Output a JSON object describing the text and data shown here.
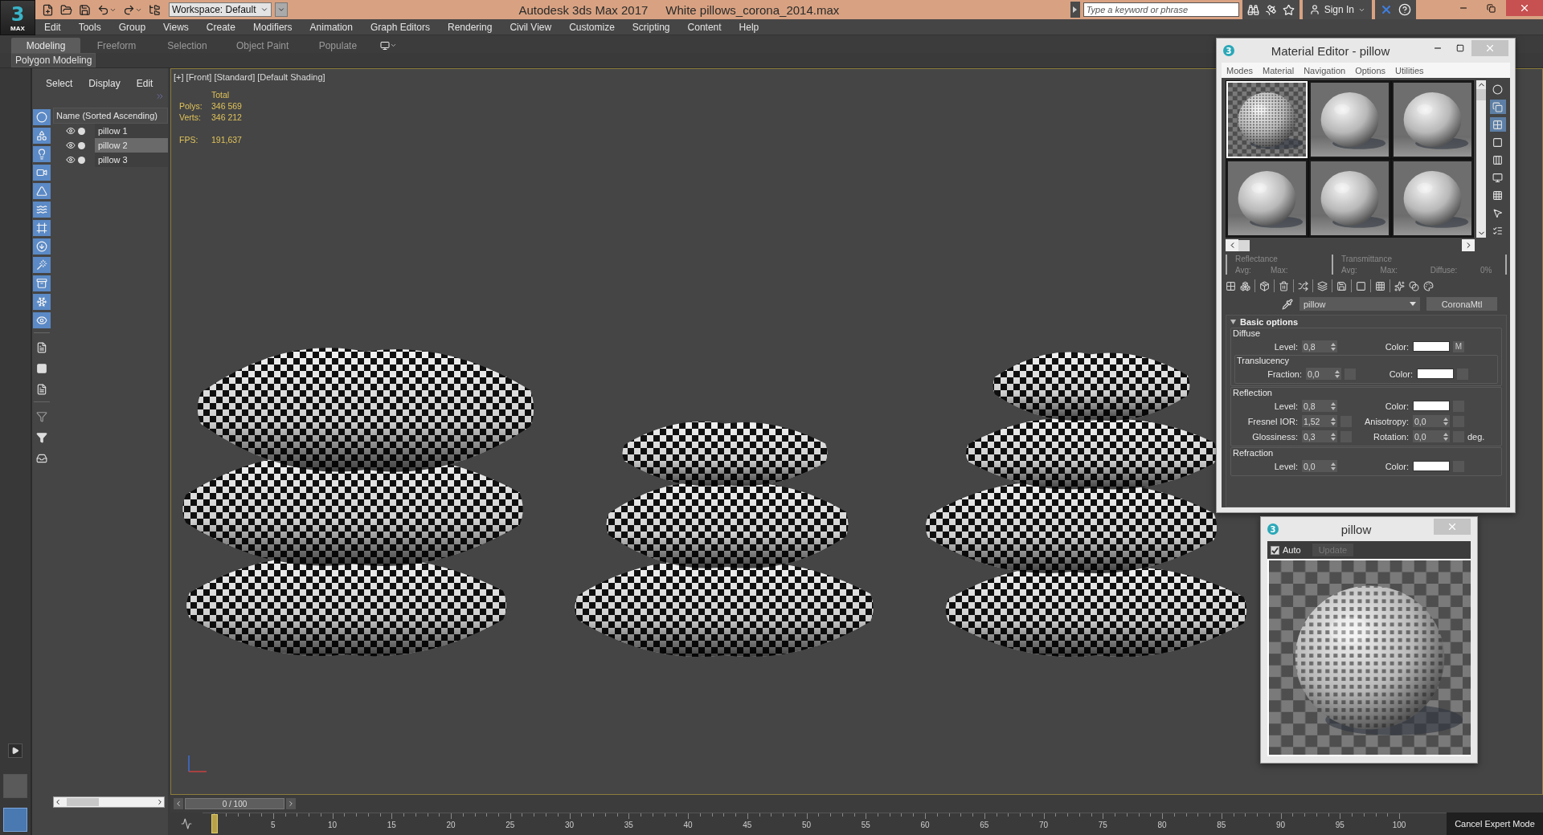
{
  "title_bar": {
    "logo": {
      "glyph": "3",
      "label": "MAX"
    },
    "workspace": "Workspace: Default",
    "app_title": "Autodesk 3ds Max 2017",
    "file_name": "White pillows_corona_2014.max",
    "search": {
      "placeholder": "Type a keyword or phrase"
    },
    "sign_in": "Sign In"
  },
  "menu": [
    "Edit",
    "Tools",
    "Group",
    "Views",
    "Create",
    "Modifiers",
    "Animation",
    "Graph Editors",
    "Rendering",
    "Civil View",
    "Customize",
    "Scripting",
    "Content",
    "Help"
  ],
  "ribbon": {
    "tabs": [
      {
        "label": "Modeling",
        "selected": true
      },
      {
        "label": "Freeform",
        "selected": false
      },
      {
        "label": "Selection",
        "selected": false
      },
      {
        "label": "Object Paint",
        "selected": false
      },
      {
        "label": "Populate",
        "selected": false
      }
    ],
    "panel": "Polygon Modeling"
  },
  "scene_explorer": {
    "tabs": [
      "Select",
      "Display",
      "Edit"
    ],
    "column": "Name (Sorted Ascending)",
    "items": [
      {
        "name": "pillow 1",
        "selected": false
      },
      {
        "name": "pillow 2",
        "selected": true
      },
      {
        "name": "pillow 3",
        "selected": false
      }
    ]
  },
  "viewport": {
    "label": "[+] [Front] [Standard] [Default Shading]",
    "stats": {
      "header": "Total",
      "rows": [
        {
          "label": "Polys:",
          "value": "346 569"
        },
        {
          "label": "Verts:",
          "value": "346 212"
        }
      ],
      "fps": {
        "label": "FPS:",
        "value": "191,637"
      }
    }
  },
  "time_slider": {
    "reading": "0 / 100",
    "level": 0,
    "ticks": [
      "5",
      "10",
      "15",
      "20",
      "25",
      "30",
      "35",
      "40",
      "45",
      "50",
      "55",
      "60",
      "65",
      "70",
      "75",
      "80",
      "85",
      "90",
      "95",
      "100"
    ]
  },
  "expert_mode_button": "Cancel Expert Mode",
  "material_editor": {
    "app_icon": "3",
    "title": "Material Editor - pillow",
    "menu": [
      "Modes",
      "Material",
      "Navigation",
      "Options",
      "Utilities"
    ],
    "slots": [
      {
        "kind": "checker",
        "selected": true
      },
      {
        "kind": "plain",
        "selected": false
      },
      {
        "kind": "plain",
        "selected": false
      },
      {
        "kind": "plain",
        "selected": false
      },
      {
        "kind": "plain",
        "selected": false
      },
      {
        "kind": "plain",
        "selected": false
      }
    ],
    "reflectance": {
      "label": "Reflectance",
      "avg": "Avg:",
      "max": "Max:"
    },
    "transmittance": {
      "label": "Transmittance",
      "avg": "Avg:",
      "max": "Max:",
      "diffuse_label": "Diffuse:",
      "diffuse_value": "0%"
    },
    "material_name": "pillow",
    "material_type": "CoronaMtl",
    "rollout": {
      "title": "Basic options",
      "expanded": true,
      "groups": [
        {
          "title": "Diffuse",
          "rows": [
            [
              {
                "kind": "spinner",
                "label": "Level:",
                "value": "0,8",
                "map_slot": false
              },
              {
                "kind": "color",
                "label": "Color:",
                "map_slot": true,
                "map_label": "M"
              }
            ]
          ],
          "children": [
            {
              "title": "Translucency",
              "rows": [
                [
                  {
                    "kind": "spinner",
                    "label": "Fraction:",
                    "value": "0,0",
                    "map_slot": true
                  },
                  {
                    "kind": "color",
                    "label": "Color:",
                    "map_slot": true
                  }
                ]
              ]
            }
          ]
        },
        {
          "title": "Reflection",
          "rows": [
            [
              {
                "kind": "spinner",
                "label": "Level:",
                "value": "0,8",
                "map_slot": false
              },
              {
                "kind": "color",
                "label": "Color:",
                "map_slot": true
              }
            ],
            [
              {
                "kind": "spinner",
                "label": "Fresnel IOR:",
                "value": "1,52",
                "map_slot": true
              },
              {
                "kind": "spinner",
                "label": "Anisotropy:",
                "value": "0,0",
                "map_slot": true
              }
            ],
            [
              {
                "kind": "spinner",
                "label": "Glossiness:",
                "value": "0,3",
                "map_slot": true
              },
              {
                "kind": "spinner",
                "label": "Rotation:",
                "value": "0,0",
                "map_slot": true,
                "unit": "deg."
              }
            ]
          ]
        },
        {
          "title": "Refraction",
          "rows": [
            [
              {
                "kind": "spinner",
                "label": "Level:",
                "value": "0,0",
                "map_slot": false
              },
              {
                "kind": "color",
                "label": "Color:",
                "map_slot": true
              }
            ]
          ]
        }
      ]
    }
  },
  "preview_window": {
    "app_icon": "3",
    "title": "pillow",
    "auto": {
      "label": "Auto",
      "checked": true
    },
    "update": {
      "label": "Update",
      "disabled": true
    }
  }
}
